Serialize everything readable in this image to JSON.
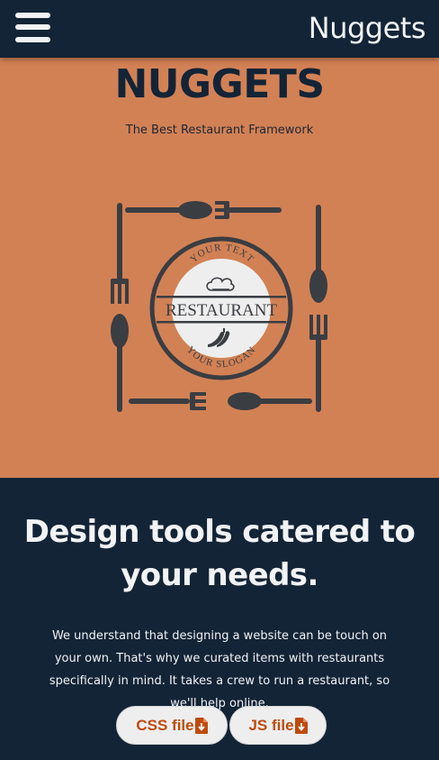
{
  "header": {
    "brand": "Nuggets",
    "menu_icon": "hamburger-menu-icon"
  },
  "hero": {
    "title": "NUGGETS",
    "tagline": "The Best Restaurant Framework",
    "logo": {
      "top_text": "YOUR TEXT",
      "name": "RESTAURANT",
      "bottom_text": "YOUR SLOGAN",
      "icons": [
        "chef-hat-icon",
        "chili-pepper-icon",
        "spoon-icon",
        "fork-icon"
      ]
    }
  },
  "content": {
    "heading": "Design tools catered to your needs.",
    "paragraph": "We understand that designing a website can be touch on your own. That's why we curated items with restaurants specifically in mind. It takes a crew to run a restaurant, so we'll help online.",
    "buttons": {
      "css_label": "CSS file",
      "js_label": "JS file",
      "download_icon": "file-download-icon"
    }
  },
  "colors": {
    "navy": "#132436",
    "orange": "#d28155",
    "button_text": "#c04a0e",
    "logo_dark": "#3a3d42"
  }
}
